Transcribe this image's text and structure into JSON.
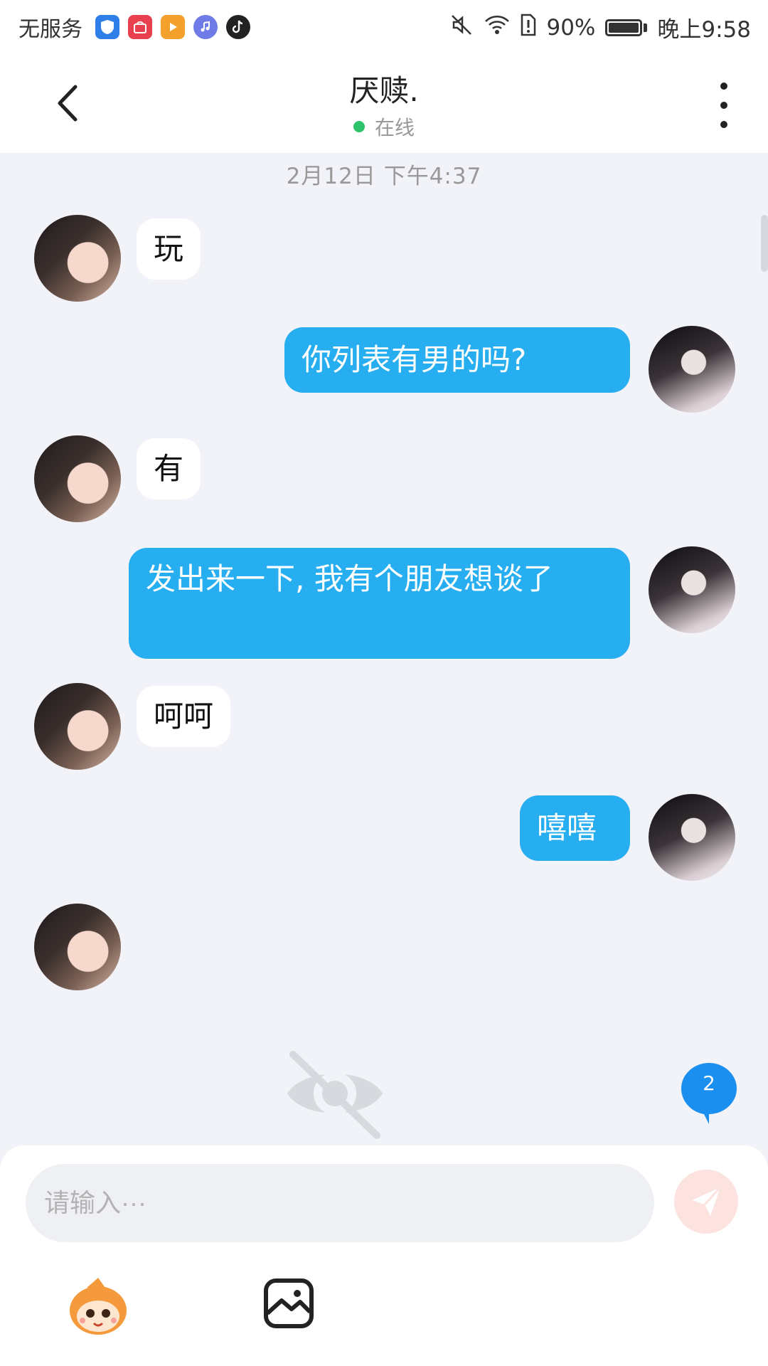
{
  "status_bar": {
    "carrier": "无服务",
    "battery": "90%",
    "time": "晚上9:58",
    "battery_level": 0.9,
    "icons": [
      "shield-app-icon",
      "huawei-store-icon",
      "video-app-icon",
      "music-app-icon",
      "tiktok-icon",
      "mute-icon",
      "wifi-icon",
      "sim-alert-icon",
      "battery-icon"
    ]
  },
  "header": {
    "title": "厌赎.",
    "status": "在线",
    "status_color": "#2ec26a",
    "back_icon": "chevron-left-icon",
    "menu_icon": "more-vertical-icon"
  },
  "chat": {
    "timestamp": "2月12日  下午4:37",
    "messages": [
      {
        "direction": "in",
        "text": "玩"
      },
      {
        "direction": "out",
        "text": "你列表有男的吗?"
      },
      {
        "direction": "in",
        "text": "有"
      },
      {
        "direction": "out",
        "text": "发出来一下, 我有个朋友想谈了"
      },
      {
        "direction": "in",
        "text": "呵呵"
      },
      {
        "direction": "out",
        "text": "嘻嘻"
      },
      {
        "direction": "in",
        "text": ""
      }
    ],
    "hidden_icon": "eye-slash-icon",
    "unread_count": "2"
  },
  "composer": {
    "placeholder": "请输入···",
    "send_icon": "paper-plane-icon",
    "tools": [
      "emoji-mascot-icon",
      "image-icon"
    ]
  },
  "colors": {
    "outgoing_bubble": "#26aef0",
    "incoming_bubble": "#ffffff",
    "background": "#f1f3f8",
    "send_button": "#fde3e0"
  }
}
